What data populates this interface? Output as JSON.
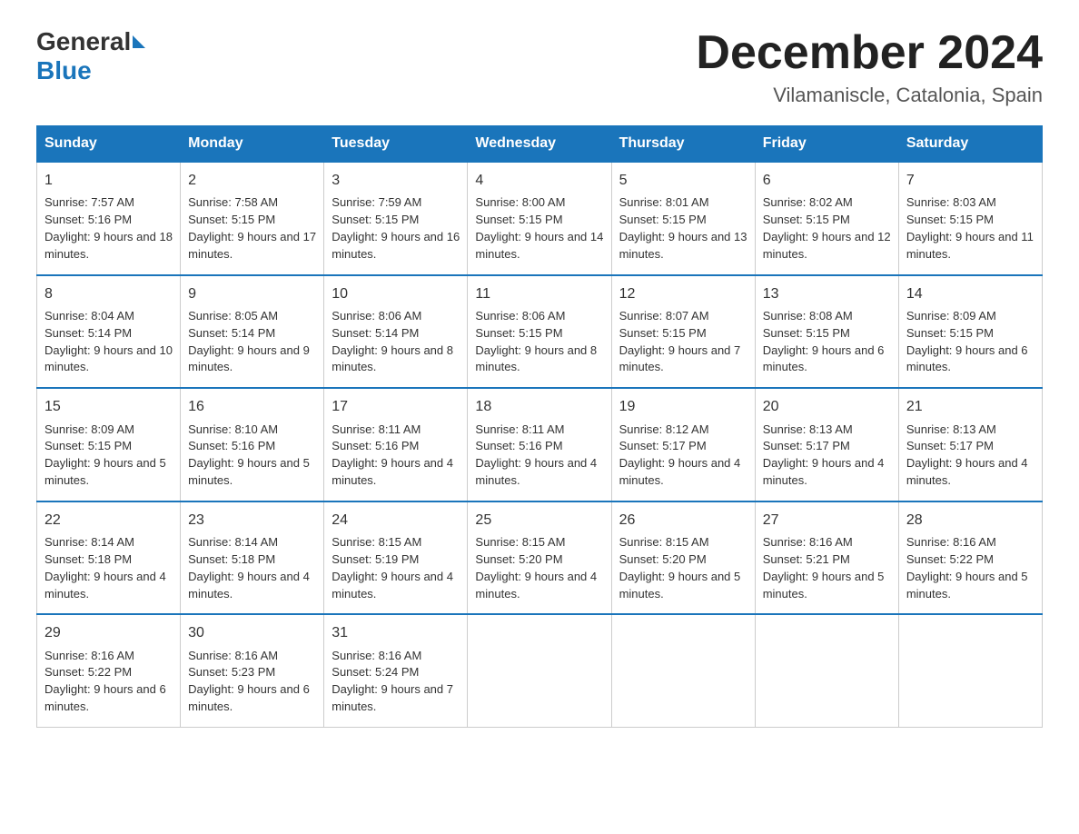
{
  "logo": {
    "general": "General",
    "blue": "Blue"
  },
  "title": "December 2024",
  "location": "Vilamaniscle, Catalonia, Spain",
  "days_of_week": [
    "Sunday",
    "Monday",
    "Tuesday",
    "Wednesday",
    "Thursday",
    "Friday",
    "Saturday"
  ],
  "weeks": [
    [
      {
        "day": "1",
        "sunrise": "Sunrise: 7:57 AM",
        "sunset": "Sunset: 5:16 PM",
        "daylight": "Daylight: 9 hours and 18 minutes."
      },
      {
        "day": "2",
        "sunrise": "Sunrise: 7:58 AM",
        "sunset": "Sunset: 5:15 PM",
        "daylight": "Daylight: 9 hours and 17 minutes."
      },
      {
        "day": "3",
        "sunrise": "Sunrise: 7:59 AM",
        "sunset": "Sunset: 5:15 PM",
        "daylight": "Daylight: 9 hours and 16 minutes."
      },
      {
        "day": "4",
        "sunrise": "Sunrise: 8:00 AM",
        "sunset": "Sunset: 5:15 PM",
        "daylight": "Daylight: 9 hours and 14 minutes."
      },
      {
        "day": "5",
        "sunrise": "Sunrise: 8:01 AM",
        "sunset": "Sunset: 5:15 PM",
        "daylight": "Daylight: 9 hours and 13 minutes."
      },
      {
        "day": "6",
        "sunrise": "Sunrise: 8:02 AM",
        "sunset": "Sunset: 5:15 PM",
        "daylight": "Daylight: 9 hours and 12 minutes."
      },
      {
        "day": "7",
        "sunrise": "Sunrise: 8:03 AM",
        "sunset": "Sunset: 5:15 PM",
        "daylight": "Daylight: 9 hours and 11 minutes."
      }
    ],
    [
      {
        "day": "8",
        "sunrise": "Sunrise: 8:04 AM",
        "sunset": "Sunset: 5:14 PM",
        "daylight": "Daylight: 9 hours and 10 minutes."
      },
      {
        "day": "9",
        "sunrise": "Sunrise: 8:05 AM",
        "sunset": "Sunset: 5:14 PM",
        "daylight": "Daylight: 9 hours and 9 minutes."
      },
      {
        "day": "10",
        "sunrise": "Sunrise: 8:06 AM",
        "sunset": "Sunset: 5:14 PM",
        "daylight": "Daylight: 9 hours and 8 minutes."
      },
      {
        "day": "11",
        "sunrise": "Sunrise: 8:06 AM",
        "sunset": "Sunset: 5:15 PM",
        "daylight": "Daylight: 9 hours and 8 minutes."
      },
      {
        "day": "12",
        "sunrise": "Sunrise: 8:07 AM",
        "sunset": "Sunset: 5:15 PM",
        "daylight": "Daylight: 9 hours and 7 minutes."
      },
      {
        "day": "13",
        "sunrise": "Sunrise: 8:08 AM",
        "sunset": "Sunset: 5:15 PM",
        "daylight": "Daylight: 9 hours and 6 minutes."
      },
      {
        "day": "14",
        "sunrise": "Sunrise: 8:09 AM",
        "sunset": "Sunset: 5:15 PM",
        "daylight": "Daylight: 9 hours and 6 minutes."
      }
    ],
    [
      {
        "day": "15",
        "sunrise": "Sunrise: 8:09 AM",
        "sunset": "Sunset: 5:15 PM",
        "daylight": "Daylight: 9 hours and 5 minutes."
      },
      {
        "day": "16",
        "sunrise": "Sunrise: 8:10 AM",
        "sunset": "Sunset: 5:16 PM",
        "daylight": "Daylight: 9 hours and 5 minutes."
      },
      {
        "day": "17",
        "sunrise": "Sunrise: 8:11 AM",
        "sunset": "Sunset: 5:16 PM",
        "daylight": "Daylight: 9 hours and 4 minutes."
      },
      {
        "day": "18",
        "sunrise": "Sunrise: 8:11 AM",
        "sunset": "Sunset: 5:16 PM",
        "daylight": "Daylight: 9 hours and 4 minutes."
      },
      {
        "day": "19",
        "sunrise": "Sunrise: 8:12 AM",
        "sunset": "Sunset: 5:17 PM",
        "daylight": "Daylight: 9 hours and 4 minutes."
      },
      {
        "day": "20",
        "sunrise": "Sunrise: 8:13 AM",
        "sunset": "Sunset: 5:17 PM",
        "daylight": "Daylight: 9 hours and 4 minutes."
      },
      {
        "day": "21",
        "sunrise": "Sunrise: 8:13 AM",
        "sunset": "Sunset: 5:17 PM",
        "daylight": "Daylight: 9 hours and 4 minutes."
      }
    ],
    [
      {
        "day": "22",
        "sunrise": "Sunrise: 8:14 AM",
        "sunset": "Sunset: 5:18 PM",
        "daylight": "Daylight: 9 hours and 4 minutes."
      },
      {
        "day": "23",
        "sunrise": "Sunrise: 8:14 AM",
        "sunset": "Sunset: 5:18 PM",
        "daylight": "Daylight: 9 hours and 4 minutes."
      },
      {
        "day": "24",
        "sunrise": "Sunrise: 8:15 AM",
        "sunset": "Sunset: 5:19 PM",
        "daylight": "Daylight: 9 hours and 4 minutes."
      },
      {
        "day": "25",
        "sunrise": "Sunrise: 8:15 AM",
        "sunset": "Sunset: 5:20 PM",
        "daylight": "Daylight: 9 hours and 4 minutes."
      },
      {
        "day": "26",
        "sunrise": "Sunrise: 8:15 AM",
        "sunset": "Sunset: 5:20 PM",
        "daylight": "Daylight: 9 hours and 5 minutes."
      },
      {
        "day": "27",
        "sunrise": "Sunrise: 8:16 AM",
        "sunset": "Sunset: 5:21 PM",
        "daylight": "Daylight: 9 hours and 5 minutes."
      },
      {
        "day": "28",
        "sunrise": "Sunrise: 8:16 AM",
        "sunset": "Sunset: 5:22 PM",
        "daylight": "Daylight: 9 hours and 5 minutes."
      }
    ],
    [
      {
        "day": "29",
        "sunrise": "Sunrise: 8:16 AM",
        "sunset": "Sunset: 5:22 PM",
        "daylight": "Daylight: 9 hours and 6 minutes."
      },
      {
        "day": "30",
        "sunrise": "Sunrise: 8:16 AM",
        "sunset": "Sunset: 5:23 PM",
        "daylight": "Daylight: 9 hours and 6 minutes."
      },
      {
        "day": "31",
        "sunrise": "Sunrise: 8:16 AM",
        "sunset": "Sunset: 5:24 PM",
        "daylight": "Daylight: 9 hours and 7 minutes."
      },
      null,
      null,
      null,
      null
    ]
  ]
}
